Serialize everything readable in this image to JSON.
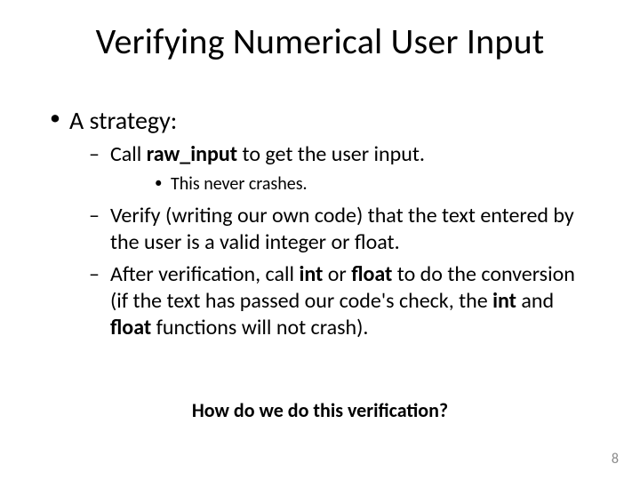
{
  "title": "Verifying Numerical User Input",
  "bullets": {
    "l1": "A strategy:",
    "l2a_pre": "Call ",
    "l2a_bold": "raw_input",
    "l2a_post": " to get the user input.",
    "l3a": "This never crashes.",
    "l2b": "Verify (writing our own code) that the text entered by the user is a valid integer or float.",
    "l2c_1": "After verification, call ",
    "l2c_int": "int",
    "l2c_2": " or ",
    "l2c_float": "float",
    "l2c_3": " to do the conversion (if the text has passed our code's check, the ",
    "l2c_int2": "int",
    "l2c_4": " and ",
    "l2c_float2": "float",
    "l2c_5": " functions will not crash)."
  },
  "question": "How do we do this verification?",
  "page_number": "8"
}
